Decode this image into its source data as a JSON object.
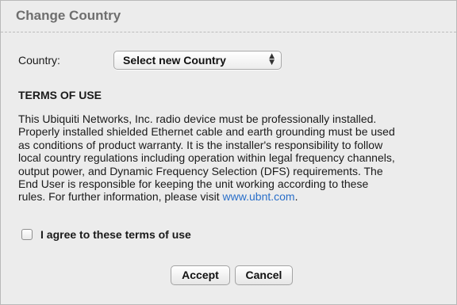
{
  "dialog": {
    "title": "Change Country"
  },
  "country": {
    "label": "Country:",
    "selected": "Select new Country"
  },
  "terms": {
    "heading": "TERMS OF USE",
    "lines": [
      "This Ubiquiti Networks, Inc. radio device must be professionally installed.",
      "Properly installed shielded Ethernet cable and earth grounding must be used",
      "as conditions of product warranty. It is the installer's responsibility to follow",
      "local country regulations including operation within legal frequency channels,",
      "output power, and Dynamic Frequency Selection (DFS) requirements. The",
      "End User is responsible for keeping the unit working according to these"
    ],
    "last_line_prefix": "rules. For further information, please visit ",
    "link_text": "www.ubnt.com",
    "last_line_suffix": "."
  },
  "agree": {
    "label": "I agree to these terms of use",
    "checked": false
  },
  "buttons": {
    "accept_label": "Accept",
    "cancel_label": "Cancel"
  },
  "colors": {
    "link": "#2a6fc9",
    "title": "#6e6e6e",
    "background": "#ececec"
  },
  "icons": {
    "select_arrows": "up-down-arrows-icon"
  }
}
